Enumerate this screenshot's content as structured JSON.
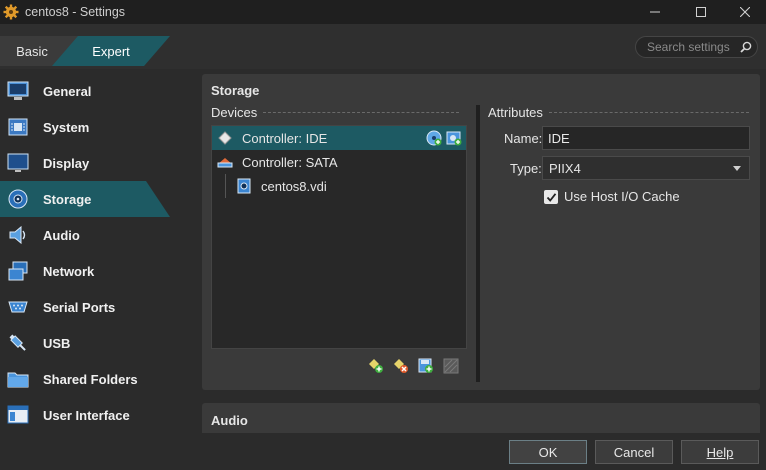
{
  "window": {
    "title": "centos8 - Settings"
  },
  "mode": {
    "basic": "Basic",
    "expert": "Expert"
  },
  "search": {
    "placeholder": "Search settings"
  },
  "sidebar": {
    "items": [
      {
        "label": "General",
        "icon": "general-icon"
      },
      {
        "label": "System",
        "icon": "system-icon"
      },
      {
        "label": "Display",
        "icon": "display-icon"
      },
      {
        "label": "Storage",
        "icon": "storage-icon",
        "active": true
      },
      {
        "label": "Audio",
        "icon": "audio-icon"
      },
      {
        "label": "Network",
        "icon": "network-icon"
      },
      {
        "label": "Serial Ports",
        "icon": "serial-ports-icon"
      },
      {
        "label": "USB",
        "icon": "usb-icon"
      },
      {
        "label": "Shared Folders",
        "icon": "shared-folders-icon"
      },
      {
        "label": "User Interface",
        "icon": "user-interface-icon"
      }
    ]
  },
  "storage": {
    "title": "Storage",
    "devices_label": "Devices",
    "attributes_label": "Attributes",
    "tree": [
      {
        "label": "Controller: IDE",
        "selected": true
      },
      {
        "label": "Controller: SATA"
      },
      {
        "label": "centos8.vdi"
      }
    ],
    "attributes": {
      "name_label": "Name:",
      "name_value": "IDE",
      "type_label": "Type:",
      "type_value": "PIIX4",
      "host_io_cache_label": "Use Host I/O Cache",
      "host_io_cache_checked": true
    }
  },
  "audio": {
    "title": "Audio"
  },
  "buttons": {
    "ok": "OK",
    "cancel": "Cancel",
    "help": "Help"
  },
  "colors": {
    "accent": "#1d5a63",
    "background": "#2b2b2b",
    "panel": "#3a3a3a"
  }
}
